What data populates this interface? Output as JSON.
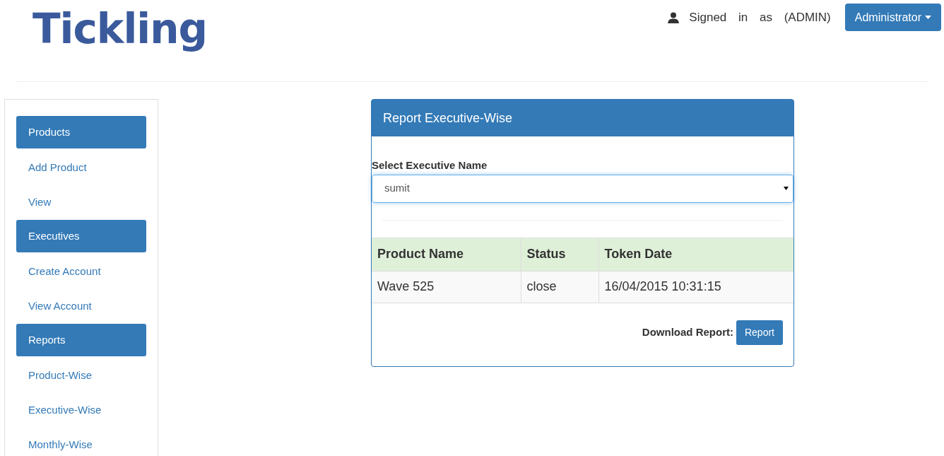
{
  "logo": "Tickling",
  "user": {
    "signed_in": "Signed in as (ADMIN)",
    "menu": "Administrator"
  },
  "sidebar": {
    "items": [
      {
        "kind": "header",
        "label": "Products"
      },
      {
        "kind": "link",
        "label": "Add Product"
      },
      {
        "kind": "link",
        "label": "View"
      },
      {
        "kind": "header",
        "label": "Executives"
      },
      {
        "kind": "link",
        "label": "Create Account"
      },
      {
        "kind": "link",
        "label": "View Account"
      },
      {
        "kind": "header",
        "label": "Reports"
      },
      {
        "kind": "link",
        "label": "Product-Wise"
      },
      {
        "kind": "link",
        "label": "Executive-Wise"
      },
      {
        "kind": "link",
        "label": "Monthly-Wise"
      }
    ]
  },
  "panel": {
    "title": "Report Executive-Wise",
    "select_label": "Select Executive Name",
    "select_value": "sumit",
    "table": {
      "columns": [
        "Product Name",
        "Status",
        "Token Date"
      ],
      "rows": [
        [
          "Wave 525",
          "close",
          "16/04/2015 10:31:15"
        ]
      ]
    },
    "download_label": "Download Report:",
    "download_button": "Report"
  }
}
